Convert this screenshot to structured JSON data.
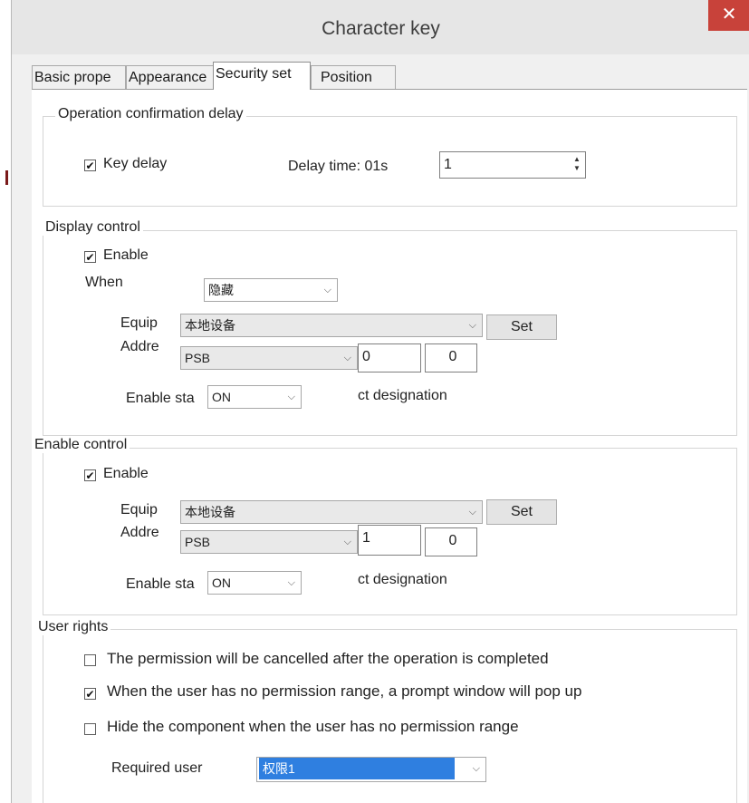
{
  "window": {
    "title": "Character key"
  },
  "tabs": [
    {
      "label": "Basic prope"
    },
    {
      "label": "Appearance"
    },
    {
      "label": "Security set"
    },
    {
      "label": "Position"
    }
  ],
  "op_delay": {
    "legend": "Operation confirmation delay",
    "key_delay_label": "Key delay",
    "key_delay_checked": true,
    "delay_time_label": "Delay time: 01s",
    "delay_value": "1"
  },
  "display_control": {
    "legend": "Display control",
    "enable_label": "Enable",
    "enable_checked": true,
    "when_label": "When",
    "when_value": "隐藏",
    "equip_label": "Equip",
    "equip_value": "本地设备",
    "set_label": "Set",
    "addr_label": "Addre",
    "addr_type": "PSB",
    "addr_value1": "0",
    "addr_value2": "0",
    "enable_state_label": "Enable sta",
    "enable_state_value": "ON",
    "designation_text": "ct designation"
  },
  "enable_control": {
    "legend": "Enable control",
    "enable_label": "Enable",
    "enable_checked": true,
    "equip_label": "Equip",
    "equip_value": "本地设备",
    "set_label": "Set",
    "addr_label": "Addre",
    "addr_type": "PSB",
    "addr_value1": "1",
    "addr_value2": "0",
    "enable_state_label": "Enable sta",
    "enable_state_value": "ON",
    "designation_text": "ct designation"
  },
  "user_rights": {
    "legend": "User rights",
    "opt1_label": "The permission will be cancelled after the operation is completed",
    "opt1_checked": false,
    "opt2_label": "When the user has no permission range, a prompt window will pop up",
    "opt2_checked": true,
    "opt3_label": "Hide the component when the user has no permission range",
    "opt3_checked": false,
    "required_user_label": "Required user",
    "required_user_value": "权限1"
  },
  "icons": {
    "close": "close-icon",
    "checkbox": "check-icon",
    "dropdown": "chevron-down-icon",
    "spinner": "spinner-icon"
  },
  "colors": {
    "close_button": "#c8423a",
    "selection": "#2f7fe0"
  }
}
